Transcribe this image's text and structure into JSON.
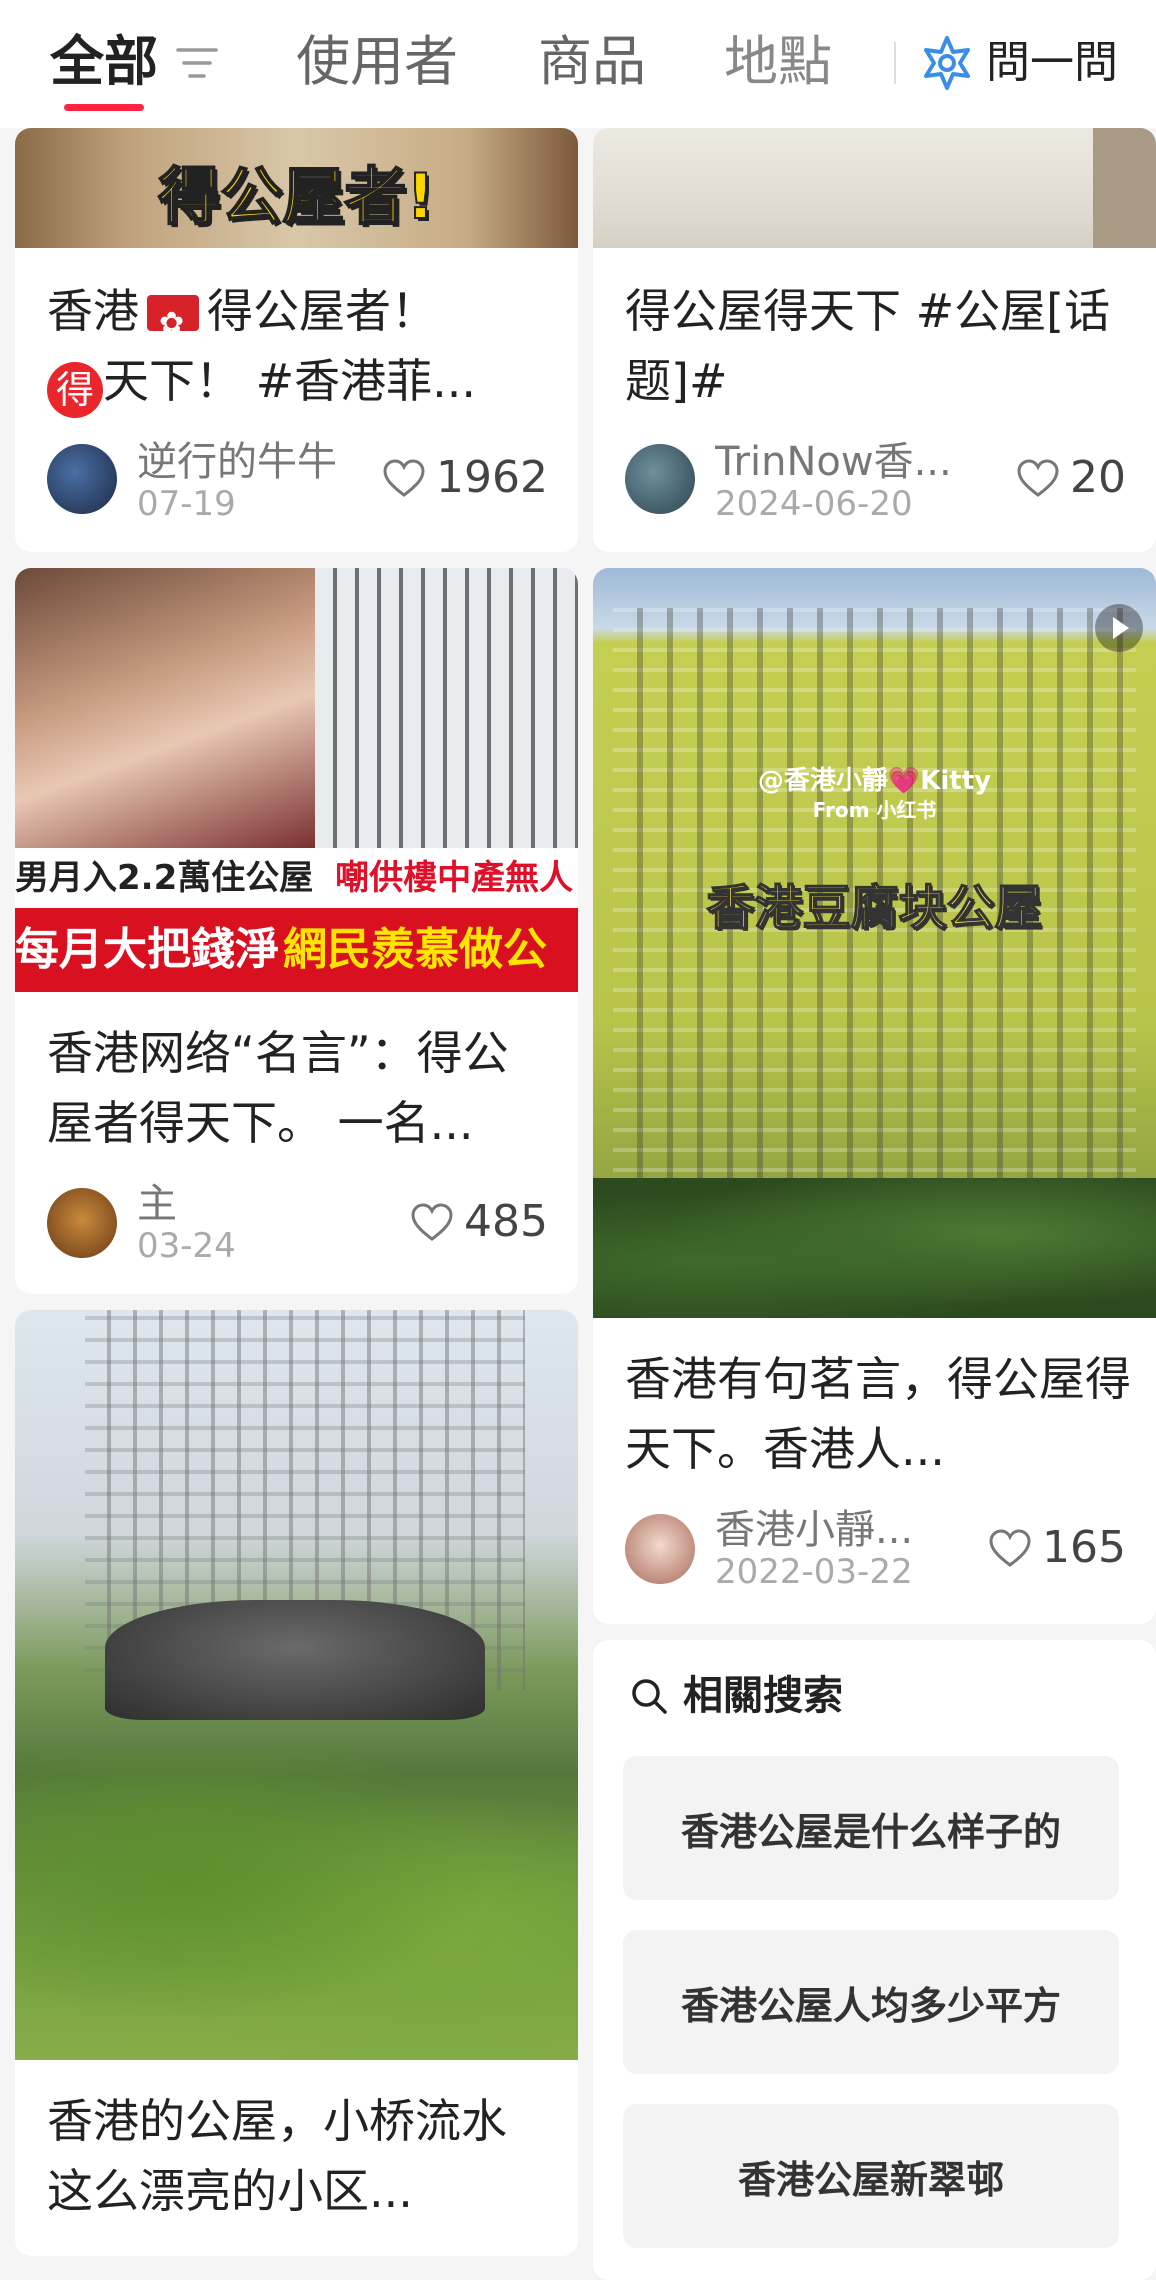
{
  "tabs": {
    "all": "全部",
    "users": "使用者",
    "products": "商品",
    "places": "地點"
  },
  "ask": {
    "label": "問一問"
  },
  "cards": {
    "c1": {
      "overlay": "得公屋者!",
      "title_a": "香港",
      "title_b": "得公屋者！",
      "title_badge": "得",
      "title_c": "天下！ #香港菲...",
      "author": "逆行的牛牛",
      "date": "07-19",
      "likes": "1962"
    },
    "c2": {
      "title": "得公屋得天下 #公屋[话题]#",
      "author": "TrinNow香...",
      "date": "2024-06-20",
      "likes": "20"
    },
    "c3": {
      "banner_left": "男月入2.2萬住公屋",
      "banner_right": "嘲供樓中產無人",
      "banner2_left": "每月大把錢淨",
      "banner2_right": "網民羨慕做公",
      "title": "香港网络“名言”：得公屋者得天下。 一名...",
      "author": "主",
      "date": "03-24",
      "likes": "485"
    },
    "c4": {
      "watermark": "@香港小靜💗Kitty",
      "watermark2": "From 小红书",
      "overlay": "香港豆腐块公屋",
      "title": "香港有句茗言，得公屋得天下。香港人...",
      "author": "香港小靜...",
      "date": "2022-03-22",
      "likes": "165"
    },
    "c5": {
      "title": "香港的公屋，小桥流水 这么漂亮的小区..."
    }
  },
  "related": {
    "heading": "相關搜索",
    "items": [
      "香港公屋是什么样子的",
      "香港公屋人均多少平方",
      "香港公屋新翠邨"
    ]
  },
  "colors": {
    "accent": "#ff2442",
    "ask_icon": "#3a8ee6"
  }
}
